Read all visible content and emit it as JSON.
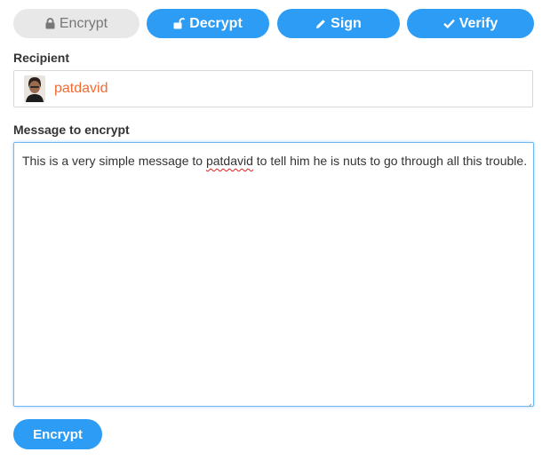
{
  "tabs": [
    {
      "label": "Encrypt",
      "icon": "lock-icon",
      "active": false
    },
    {
      "label": "Decrypt",
      "icon": "unlock-icon",
      "active": true
    },
    {
      "label": "Sign",
      "icon": "pencil-icon",
      "active": true
    },
    {
      "label": "Verify",
      "icon": "check-icon",
      "active": true
    }
  ],
  "recipient": {
    "label": "Recipient",
    "name": "patdavid",
    "avatar": "user-avatar"
  },
  "message": {
    "label": "Message to encrypt",
    "text_before": "This is a very simple message to ",
    "misspelled_word": "patdavid",
    "text_after": " to tell him he is nuts to go through all this trouble."
  },
  "submit": {
    "label": "Encrypt"
  },
  "colors": {
    "accent": "#2c9cf5",
    "inactive_tab": "#e8e8e8",
    "recipient_text": "#f26b35",
    "spellcheck": "#e02020"
  }
}
